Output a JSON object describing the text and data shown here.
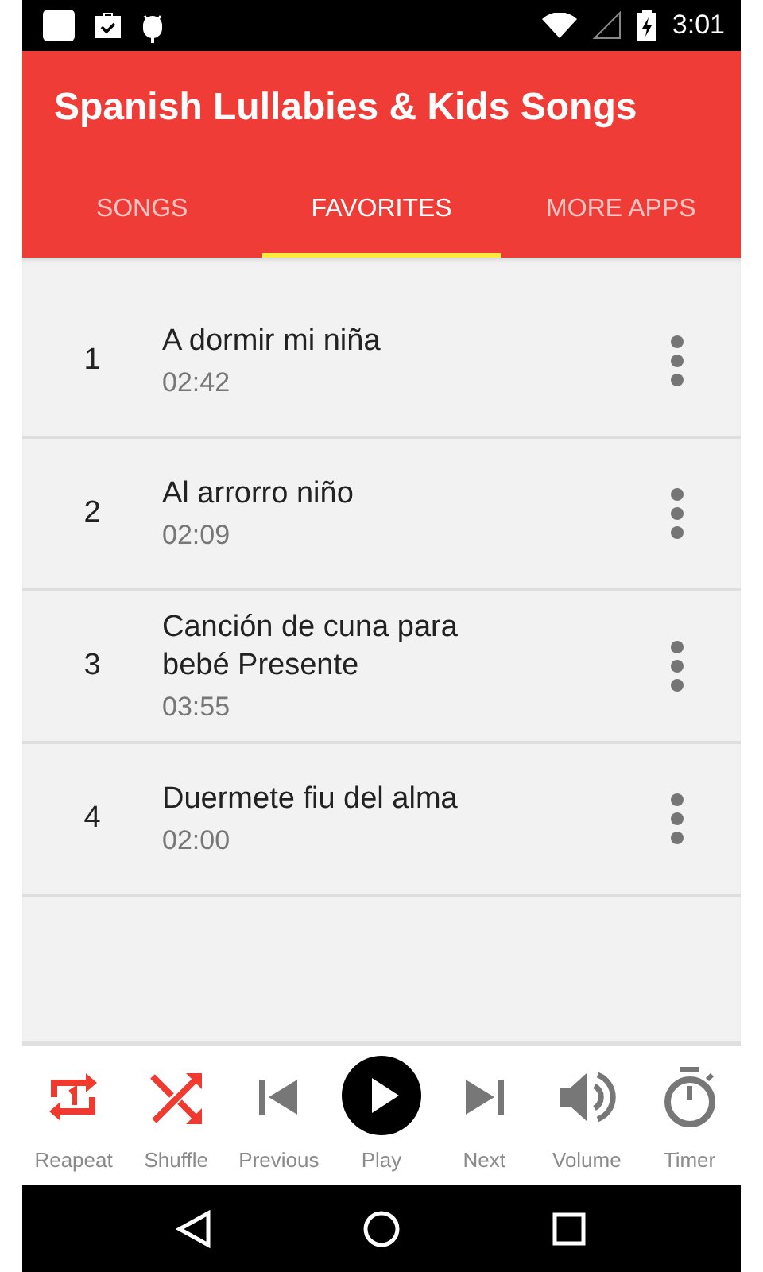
{
  "status_bar": {
    "time": "3:01"
  },
  "app_bar": {
    "title": "Spanish Lullabies & Kids Songs"
  },
  "tabs": [
    {
      "label": "SONGS",
      "selected": false
    },
    {
      "label": "FAVORITES",
      "selected": true
    },
    {
      "label": "MORE APPS",
      "selected": false
    }
  ],
  "songs": [
    {
      "number": "1",
      "title": "A dormir mi niña",
      "duration": "02:42"
    },
    {
      "number": "2",
      "title": "Al arrorro niño",
      "duration": "02:09"
    },
    {
      "number": "3",
      "title": "Canción de cuna para bebé Presente",
      "duration": "03:55"
    },
    {
      "number": "4",
      "title": "Duermete fiu del alma",
      "duration": "02:00"
    }
  ],
  "controls": [
    {
      "kind": "repeat",
      "label": "Reapeat",
      "on": true
    },
    {
      "kind": "shuffle",
      "label": "Shuffle",
      "on": true
    },
    {
      "kind": "previous",
      "label": "Previous",
      "on": false
    },
    {
      "kind": "play",
      "label": "Play",
      "on": false
    },
    {
      "kind": "next",
      "label": "Next",
      "on": false
    },
    {
      "kind": "volume",
      "label": "Volume",
      "on": false
    },
    {
      "kind": "timer",
      "label": "Timer",
      "on": false
    }
  ]
}
